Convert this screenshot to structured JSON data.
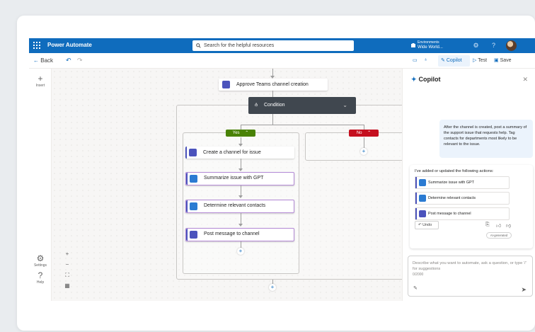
{
  "app": {
    "title": "Power Automate"
  },
  "search": {
    "placeholder": "Search for the helpful resources"
  },
  "environment": {
    "label": "Environments",
    "name": "Wide World..."
  },
  "cmdbar": {
    "back": "Back",
    "copilot": "Copilot",
    "test": "Test",
    "save": "Save"
  },
  "rail": {
    "insert": "Insert",
    "settings": "Settings",
    "help": "Help"
  },
  "flow": {
    "top_action": "Approve Teams channel creation",
    "condition": "Condition",
    "yes_label": "Yes",
    "no_label": "No",
    "yes_actions": [
      "Create a channel for issue",
      "Summarize issue with GPT",
      "Determine relevant contacts",
      "Post message to channel"
    ]
  },
  "copilot": {
    "title": "Copilot",
    "user_message": "After the channel is created, post a summary of the support issue that requests help. Tag contacts for departments most likely to be relevant to the issue.",
    "response_text": "I've added or updated the following actions:",
    "actions": [
      "Summarize issue with GPT",
      "Determine relevant contacts",
      "Post message to channel"
    ],
    "undo": "Undo",
    "ai_tag": "AI-generated",
    "compose_placeholder": "Describe what you want to automate, ask a question, or type '/' for suggestions",
    "compose_counter": "0/2000"
  },
  "colors": {
    "brand": "#0f6cbd",
    "condition": "#40474f",
    "yes": "#498205",
    "no": "#c50f1f",
    "teams": "#4b53bc"
  }
}
